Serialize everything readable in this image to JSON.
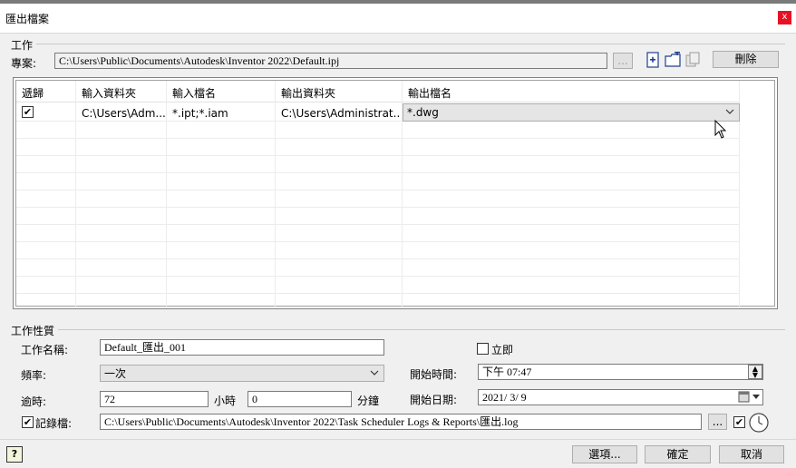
{
  "window": {
    "title": "匯出檔案",
    "close_label": "x"
  },
  "task_group": {
    "label": "工作",
    "project_label": "專案:",
    "project_path": "C:\\Users\\Public\\Documents\\Autodesk\\Inventor 2022\\Default.ipj",
    "browse_label": "...",
    "delete_label": "刪除"
  },
  "grid": {
    "headers": [
      "遞歸",
      "輸入資料夾",
      "輸入檔名",
      "輸出資料夾",
      "輸出檔名"
    ],
    "rows": [
      {
        "recursive": "✔",
        "input_folder": "C:\\Users\\Adm...",
        "input_name": "*.ipt;*.iam",
        "output_folder": "C:\\Users\\Administrat...",
        "output_name": "*.dwg"
      }
    ]
  },
  "props": {
    "label": "工作性質",
    "task_name_label": "工作名稱:",
    "task_name": "Default_匯出_001",
    "immediate_label": "立即",
    "frequency_label": "頻率:",
    "frequency": "一次",
    "start_time_label": "開始時間:",
    "start_time": "下午 07:47",
    "timeout_label": "逾時:",
    "hours": "72",
    "hours_label": "小時",
    "minutes": "0",
    "minutes_label": "分鐘",
    "start_date_label": "開始日期:",
    "start_date": "2021/ 3/ 9",
    "log_label": "記錄檔:",
    "log_path": "C:\\Users\\Public\\Documents\\Autodesk\\Inventor 2022\\Task Scheduler Logs & Reports\\匯出.log",
    "log_browse": "..."
  },
  "footer": {
    "help_label": "?",
    "options_label": "選項...",
    "ok_label": "確定",
    "cancel_label": "取消"
  }
}
